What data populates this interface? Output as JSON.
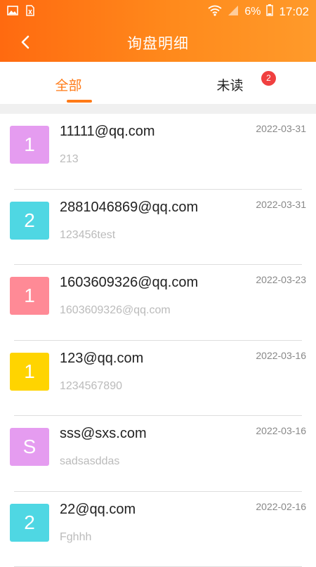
{
  "status_bar": {
    "time": "17:02",
    "battery_percent": "6%",
    "left_icons": [
      "image-icon",
      "sim-icon"
    ],
    "right_icons": [
      "wifi-icon",
      "signal-icon",
      "battery-icon"
    ]
  },
  "header": {
    "title": "询盘明细",
    "back_icon": "chevron-left-icon",
    "gradient": [
      "#ff6a10",
      "#ff9a2a"
    ]
  },
  "tabs": {
    "all_label": "全部",
    "unread_label": "未读",
    "unread_count": "2",
    "active": "all",
    "accent": "#ff7a17"
  },
  "inquiries": [
    {
      "avatar": "1",
      "avatar_color": "#e59cf0",
      "email": "11111@qq.com",
      "date": "2022-03-31",
      "message": "213"
    },
    {
      "avatar": "2",
      "avatar_color": "#4fd7e3",
      "email": "2881046869@qq.com",
      "date": "2022-03-31",
      "message": "123456test"
    },
    {
      "avatar": "1",
      "avatar_color": "#ff8a96",
      "email": "1603609326@qq.com",
      "date": "2022-03-23",
      "message": "1603609326@qq.com"
    },
    {
      "avatar": "1",
      "avatar_color": "#ffd400",
      "email": "123@qq.com",
      "date": "2022-03-16",
      "message": "1234567890"
    },
    {
      "avatar": "S",
      "avatar_color": "#e59cf0",
      "email": "sss@sxs.com",
      "date": "2022-03-16",
      "message": "sadsasddas"
    },
    {
      "avatar": "2",
      "avatar_color": "#4fd7e3",
      "email": "22@qq.com",
      "date": "2022-02-16",
      "message": "Fghhh"
    }
  ]
}
